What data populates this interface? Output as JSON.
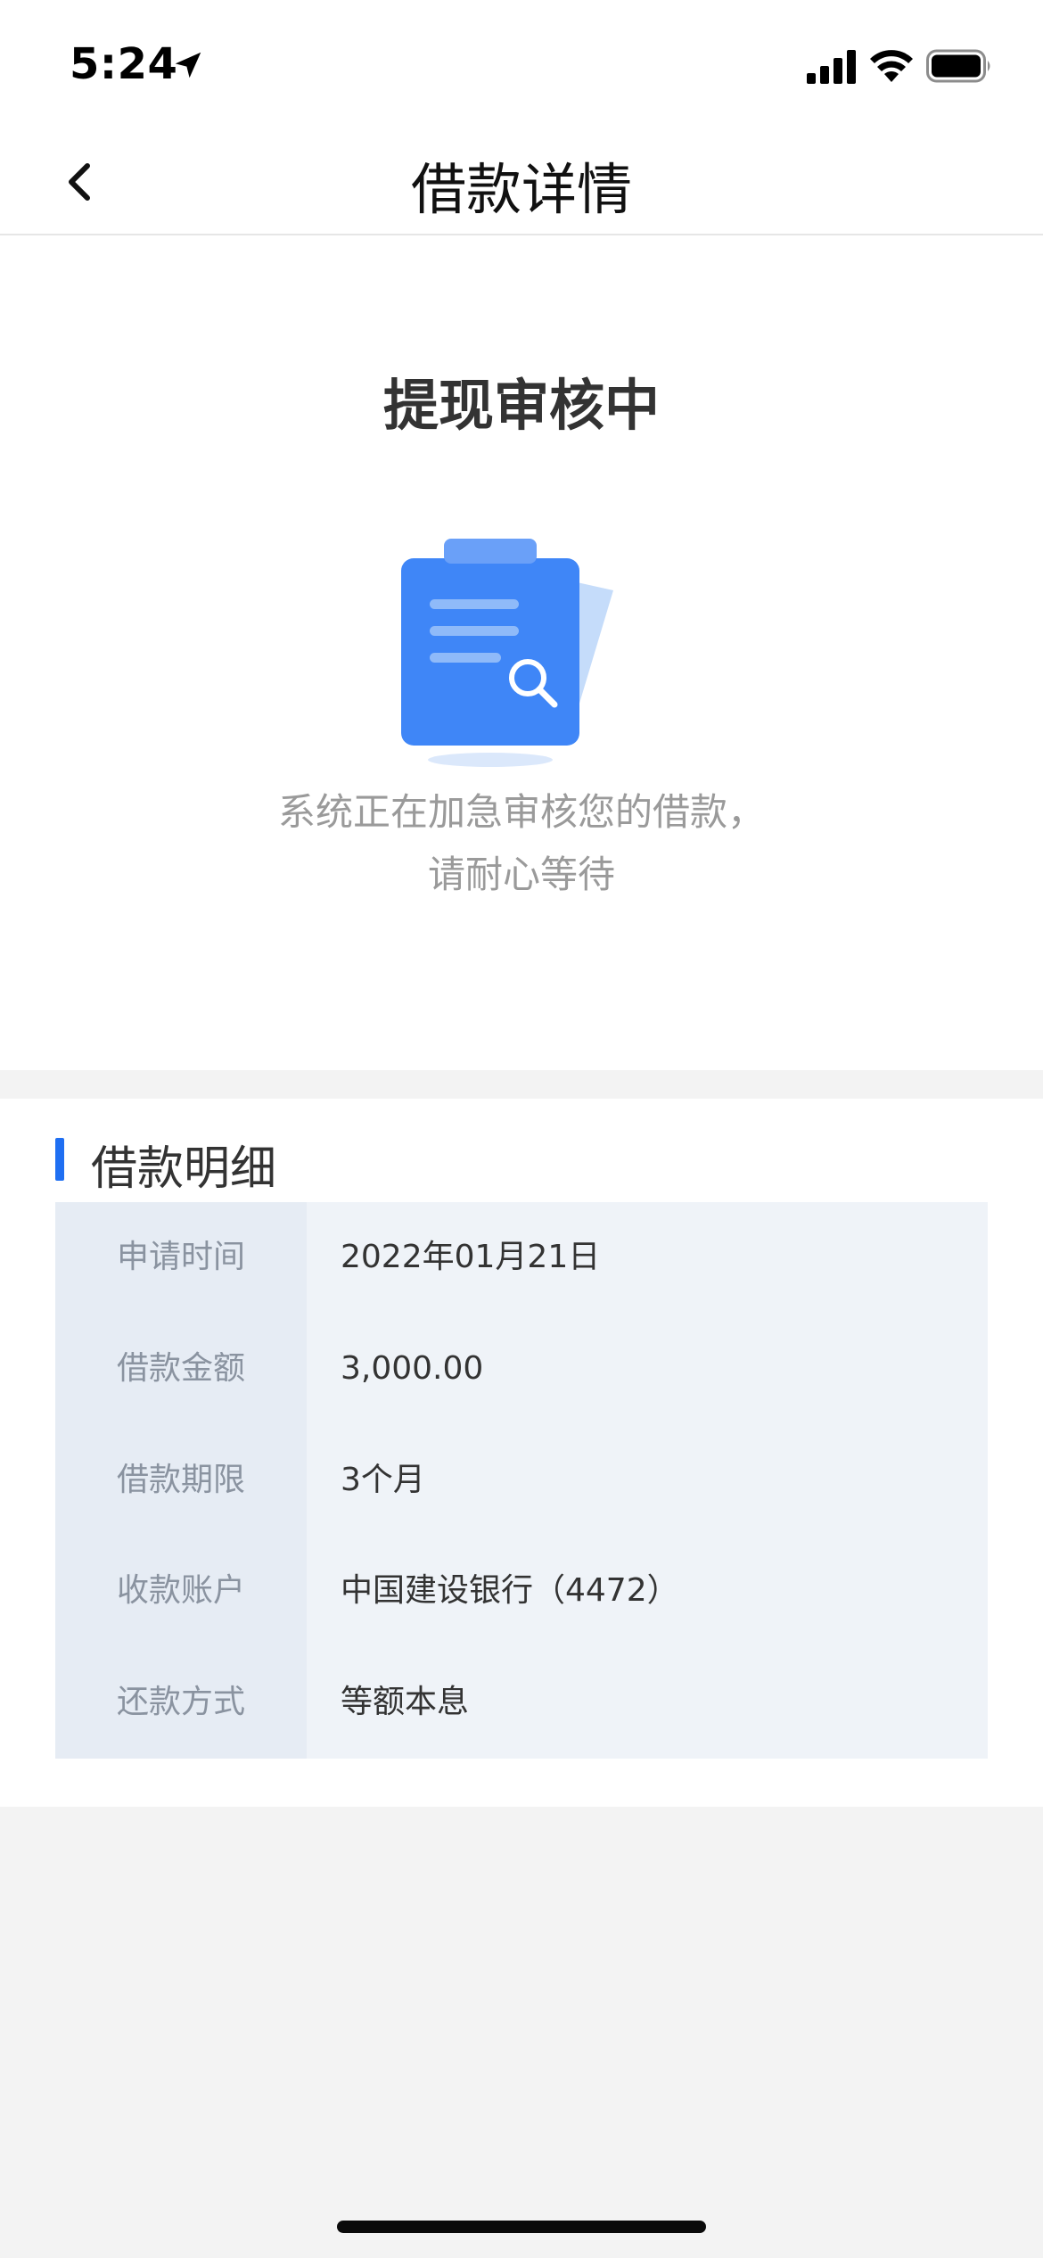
{
  "status_bar": {
    "time": "5:24"
  },
  "nav": {
    "title": "借款详情"
  },
  "status_card": {
    "title": "提现审核中",
    "description_line1": "系统正在加急审核您的借款，",
    "description_line2": "请耐心等待"
  },
  "details": {
    "section_title": "借款明细",
    "rows": [
      {
        "label": "申请时间",
        "value": "2022年01月21日"
      },
      {
        "label": "借款金额",
        "value": "3,000.00"
      },
      {
        "label": "借款期限",
        "value": "3个月"
      },
      {
        "label": "收款账户",
        "value": "中国建设银行（4472）"
      },
      {
        "label": "还款方式",
        "value": "等额本息"
      }
    ]
  },
  "colors": {
    "accent": "#1f6ff2",
    "table_bg": "#eff3f8",
    "label_col_bg": "#e6ecf4",
    "page_bg": "#f3f3f3"
  }
}
